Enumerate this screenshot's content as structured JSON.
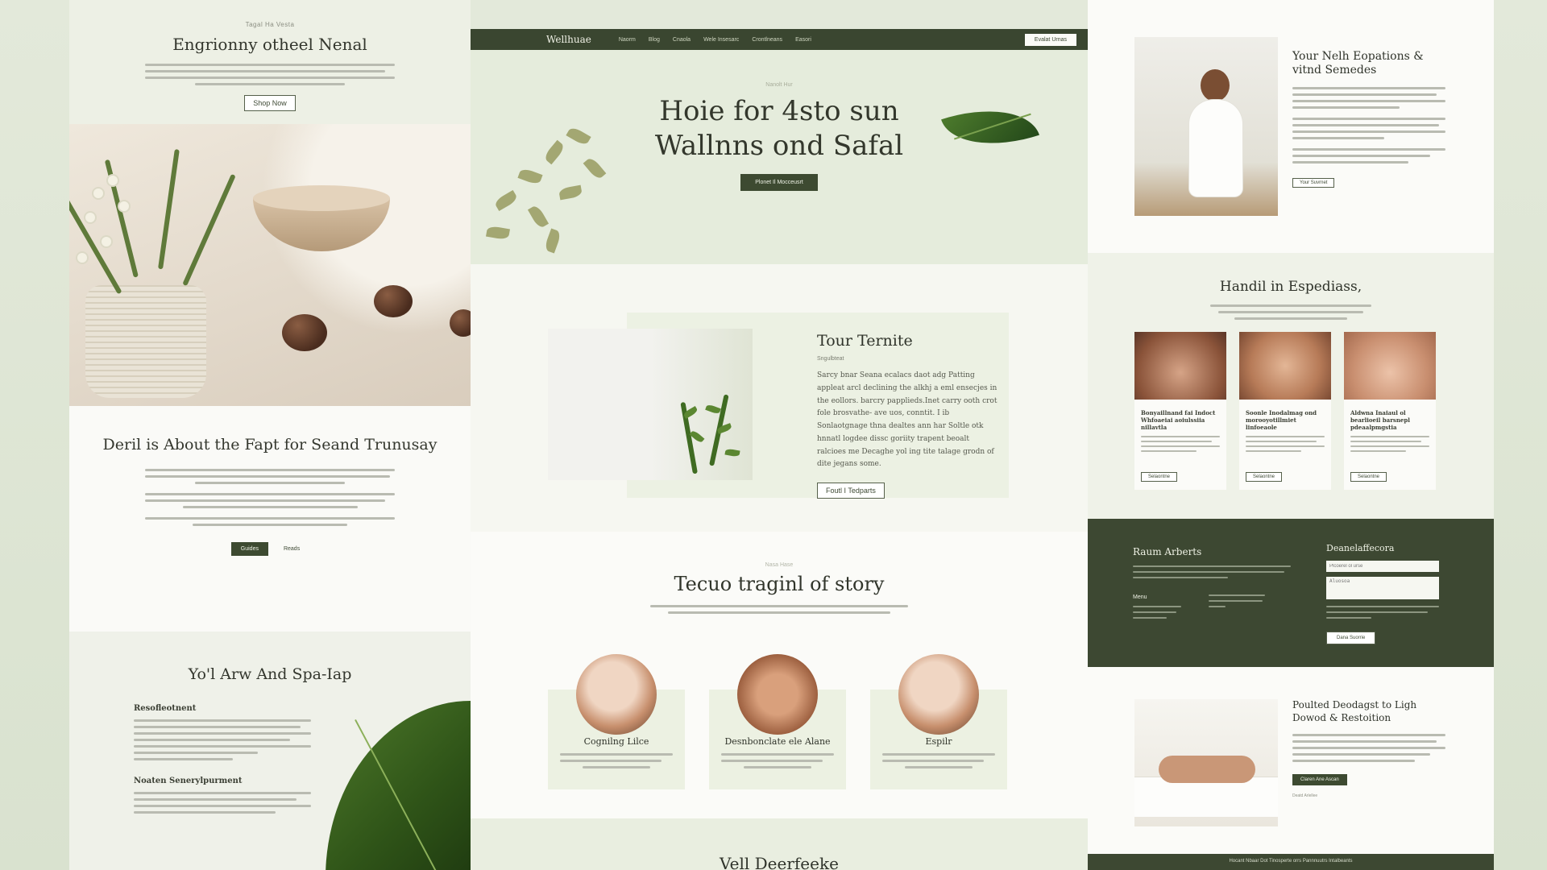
{
  "left": {
    "eyebrow": "Tagal Ha Vesta",
    "title": "Engrionny otheel Nenal",
    "cta": "Shop Now",
    "about_title": "Deril is About the Fapt for Seand Trunusay",
    "btn_primary": "Guides",
    "btn_secondary": "Reads",
    "section_title": "Yo'l Arw And Spa-Iap",
    "sub1": "Resofleotnent",
    "sub2": "Noaten Senerylpurment"
  },
  "center": {
    "nav": {
      "logo": "Wellhuae",
      "links": [
        "Naorm",
        "Blog",
        "Cnaola",
        "Wele Insesarc",
        "Crontlneans",
        "Easori"
      ],
      "button": "Evalat Urnas"
    },
    "hero": {
      "eyebrow": "Nanolt Hur",
      "title": "Hoie for 4sto sun Wallnns ond Safal",
      "cta": "Plonet Il Mocceusrt"
    },
    "feature": {
      "title": "Tour Ternite",
      "subtitle": "Sngulbteat",
      "body": "Sarcy bnar Seana ecalacs daot adg Patting appleat arcl declining the alkhj a eml ensecjes in the eollors. barcry papplieds.Inet carry ooth crot fole brosvathe- ave uos, conntit. I ib Sonlaotgnage thna dealtes ann har Soltle otk hnnatl logdee dissc goriity trapent beoalt ralcioes me Decaghe yol ing tite talage grodn of dite jegans some.",
      "cta": "Foutl I Tedparts"
    },
    "story": {
      "eyebrow": "Nasa Hase",
      "title": "Tecuo traginl of story",
      "cards": [
        {
          "name": "Cognilng Lilce"
        },
        {
          "name": "Desnbonclate ele Alane"
        },
        {
          "name": "Espilr"
        }
      ]
    },
    "footer_peek": "Vell Deerfeeke"
  },
  "right": {
    "s1_title": "Your Nelh Eopations & vitnd Semedes",
    "s1_btn": "Your Suvrnet",
    "s2_title": "Handil in Espediass,",
    "minis": [
      {
        "title": "Bonyaillnand fai Indoct Whfoaeiai aoiulssiia nillavtla"
      },
      {
        "title": "Soonle Inodalmag ond morooyotillmiet linfoeaole"
      },
      {
        "title": "Aldwna Inaiaul ol bearlioeil barsnepl pdeaalpmgstia"
      }
    ],
    "mini_btn": "Selaontne",
    "s3_title": "Raum Arberts",
    "s3_links_title": "Menu",
    "s3_form_title": "Deanelaffecora",
    "s3_input1": "Plcoerel ol urse",
    "s3_input2": "Aluosoa",
    "s3_btn": "Dana Suorrie",
    "s4_title": "Poulted Deodagst to Ligh Dowod & Restoition",
    "s4_btn": "Claren Ane Ascan",
    "s4_small": "Deatd Arlellee",
    "footer": "Hocant Nbaar Dot Tinosperte orrs Pannnuutrs Intalbeants"
  }
}
